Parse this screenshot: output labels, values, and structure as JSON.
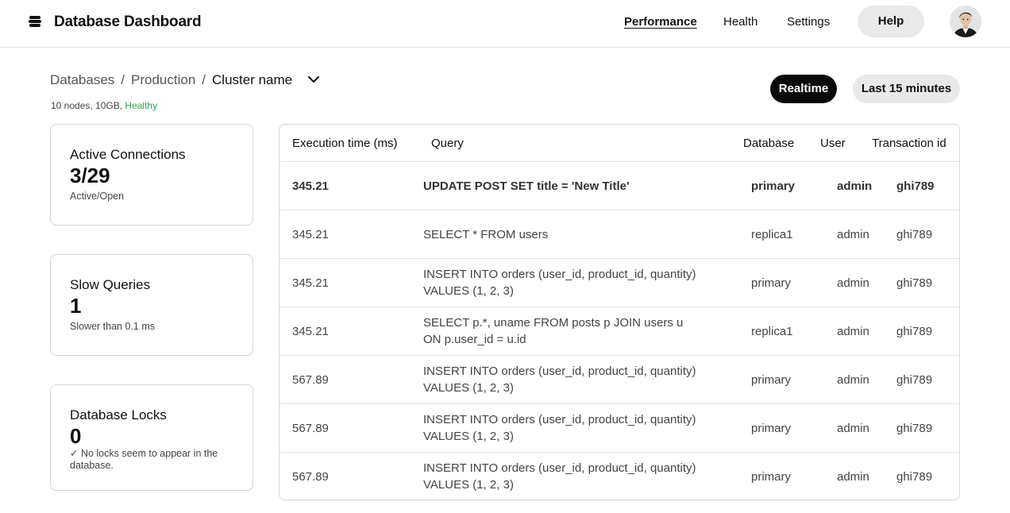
{
  "header": {
    "app_title": "Database Dashboard",
    "logo_icon": "stack-icon",
    "nav": [
      {
        "label": "Performance",
        "active": true
      },
      {
        "label": "Health",
        "active": false
      },
      {
        "label": "Settings",
        "active": false
      }
    ],
    "help_label": "Help",
    "avatar_icon": "user-avatar"
  },
  "breadcrumb": {
    "items": [
      "Databases",
      "Production",
      "Cluster name"
    ],
    "separator": "/",
    "dropdown_icon": "chevron-down-icon"
  },
  "cluster": {
    "meta": "10 nodes, 10GB,",
    "status": "Healthy",
    "status_color": "#2e9e4f"
  },
  "time_range": {
    "realtime_label": "Realtime",
    "range_label": "Last 15 minutes"
  },
  "cards": [
    {
      "title": "Active Connections",
      "value": "3/29",
      "note": "Active/Open"
    },
    {
      "title": "Slow Queries",
      "value": "1",
      "note": "Slower than 0.1 ms"
    },
    {
      "title": "Database Locks",
      "value": "0",
      "note": "✓ No locks seem to appear in the database."
    }
  ],
  "table": {
    "columns": [
      "Execution time (ms)",
      "Query",
      "Database",
      "User",
      "Transaction id"
    ],
    "rows": [
      {
        "time": "345.21",
        "query": "UPDATE POST SET title = 'New Title'",
        "database": "primary",
        "user": "admin",
        "txid": "ghi789"
      },
      {
        "time": "345.21",
        "query": "SELECT * FROM users",
        "database": "replica1",
        "user": "admin",
        "txid": "ghi789"
      },
      {
        "time": "345.21",
        "query": "INSERT INTO orders (user_id, product_id, quantity) VALUES (1, 2, 3)",
        "database": "primary",
        "user": "admin",
        "txid": "ghi789"
      },
      {
        "time": "345.21",
        "query": "SELECT p.*, uname FROM posts p JOIN users u ON p.user_id = u.id",
        "database": "replica1",
        "user": "admin",
        "txid": "ghi789"
      },
      {
        "time": "567.89",
        "query": "INSERT INTO orders (user_id, product_id, quantity) VALUES (1, 2, 3)",
        "database": "primary",
        "user": "admin",
        "txid": "ghi789"
      },
      {
        "time": "567.89",
        "query": "INSERT INTO orders (user_id, product_id, quantity) VALUES (1, 2, 3)",
        "database": "primary",
        "user": "admin",
        "txid": "ghi789"
      },
      {
        "time": "567.89",
        "query": "INSERT INTO orders (user_id, product_id, quantity) VALUES (1, 2, 3)",
        "database": "primary",
        "user": "admin",
        "txid": "ghi789"
      }
    ]
  }
}
